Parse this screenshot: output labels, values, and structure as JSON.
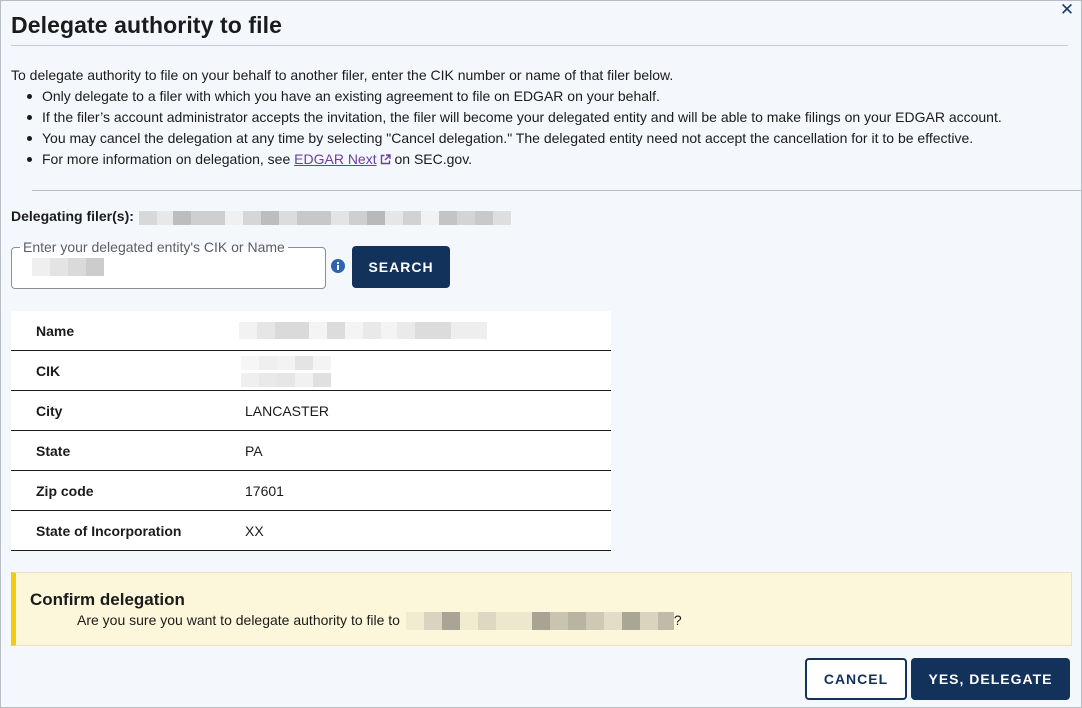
{
  "dialog": {
    "title": "Delegate authority to file",
    "close_symbol": "✕"
  },
  "intro": {
    "text": "To delegate authority to file on your behalf to another filer, enter the CIK number or name of that filer below.",
    "bullets": [
      "Only delegate to a filer with which you have an existing agreement to file on EDGAR on your behalf.",
      "If the filer’s account administrator accepts the invitation, the filer will become your delegated entity and will be able to make filings on your EDGAR account.",
      "You may cancel the delegation at any time by selecting \"Cancel delegation.\" The delegated entity need not accept the cancellation for it to be effective."
    ],
    "more_info_prefix": "For more information on delegation, see ",
    "more_info_link": "EDGAR Next",
    "more_info_suffix": " on SEC.gov."
  },
  "delegating": {
    "label": "Delegating filer(s):"
  },
  "search": {
    "field_label": "Enter your delegated entity's CIK or Name",
    "button_label": "SEARCH",
    "info_icon": "info-icon"
  },
  "details": [
    {
      "key": "Name",
      "value": ""
    },
    {
      "key": "CIK",
      "value": ""
    },
    {
      "key": "City",
      "value": "LANCASTER"
    },
    {
      "key": "State",
      "value": "PA"
    },
    {
      "key": "Zip code",
      "value": "17601"
    },
    {
      "key": "State of Incorporation",
      "value": "XX"
    }
  ],
  "confirm": {
    "title": "Confirm delegation",
    "text_prefix": "Are you sure you want to delegate authority to file to",
    "text_suffix": "?"
  },
  "actions": {
    "cancel_label": "CANCEL",
    "confirm_label": "YES, DELEGATE"
  },
  "colors": {
    "primary": "#13325b",
    "alert_accent": "#f2cc0c",
    "alert_bg": "#fcf6da",
    "link": "#6b3fa0"
  }
}
